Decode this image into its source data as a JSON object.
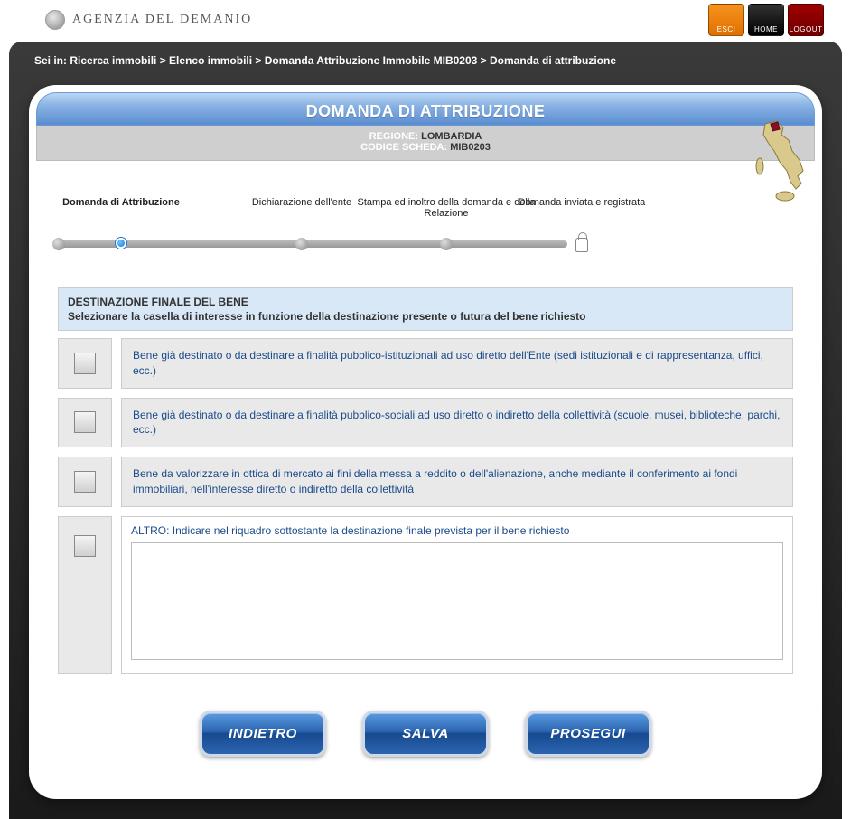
{
  "brand": {
    "name": "AGENZIA DEL DEMANIO"
  },
  "nav": {
    "esci": "ESCI",
    "home": "HOME",
    "logout": "LOGOUT"
  },
  "breadcrumb": "Sei in: Ricerca immobili > Elenco immobili > Domanda Attribuzione Immobile MIB0203 > Domanda di attribuzione",
  "header": {
    "title": "DOMANDA DI ATTRIBUZIONE",
    "region_label": "REGIONE:",
    "region_value": "LOMBARDIA",
    "code_label": "CODICE SCHEDA:",
    "code_value": "MIB0203"
  },
  "wizard": {
    "step1": "Domanda di Attribuzione",
    "step2": "Dichiarazione dell'ente",
    "step3": "Stampa ed inoltro della domanda e della Relazione",
    "step4": "Domanda inviata e registrata"
  },
  "section": {
    "title": "DESTINAZIONE FINALE DEL BENE",
    "desc": "Selezionare la casella di interesse in funzione della destinazione presente o futura del bene richiesto"
  },
  "options": {
    "opt1": "Bene già destinato o da destinare a finalità pubblico-istituzionali ad uso diretto dell'Ente (sedi istituzionali e di rappresentanza, uffici, ecc.)",
    "opt2": "Bene già destinato o da destinare a finalità pubblico-sociali ad uso diretto o indiretto della collettività (scuole, musei, biblioteche, parchi, ecc.)",
    "opt3": "Bene da valorizzare in ottica di mercato ai fini della messa a reddito o dell'alienazione, anche mediante il conferimento ai fondi immobiliari, nell'interesse diretto o indiretto della collettività",
    "opt4_label": "ALTRO: Indicare nel riquadro sottostante la destinazione finale prevista per il bene richiesto",
    "opt4_value": ""
  },
  "buttons": {
    "back": "INDIETRO",
    "save": "SALVA",
    "next": "PROSEGUI"
  }
}
